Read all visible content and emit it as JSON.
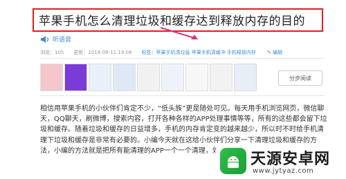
{
  "article": {
    "title": "苹果手机怎么清理垃圾和缓存达到释放内存的目的",
    "listen_label": "听语音",
    "views": "浏览：105",
    "updated": "更新：2018-08-11 19:08",
    "tags": "标签：苹果手机清垃圾 苹果手机清缓冲 手机释放内存",
    "edit_label": "编辑",
    "step_read_label": "分步阅读",
    "paragraph": "相信用苹果手机的小伙伴们肯定不少，“低头族”更是随处可见。每天用手机浏览网页，微信聊天，QQ聊天，刷微博，搜索内容，打开各种各样的APP处理事情等等，所有的这些都会留下垃圾和缓存。随着垃圾和缓存的日益增多，手机的内存肯定变的越来越少，所以时不时给手机清理下垃圾和缓存是非常有必要的。小编今天就在这给小伙伴们分享一下清理垃圾和缓存的方法，小编的方法就是把所有能清理的APP一个一个清理，效果很明显。"
  },
  "watermark": {
    "title": "天源安卓网",
    "url": "www.jytyaz.com"
  },
  "colors": {
    "title_border": "#e11d1d",
    "link": "#3a8be0",
    "arrow": "#d63384"
  },
  "icons": {
    "speaker": "speaker-icon",
    "edit": "pencil-icon",
    "logo": "android-logo-icon"
  }
}
